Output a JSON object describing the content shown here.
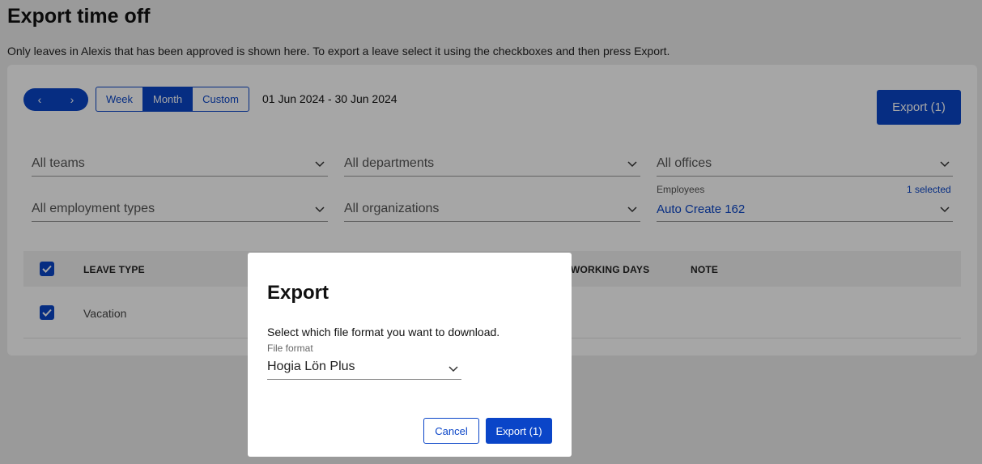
{
  "page": {
    "title": "Export time off",
    "description": "Only leaves in Alexis that has been approved is shown here. To export a leave select it using the checkboxes and then press Export."
  },
  "toolbar": {
    "prev_icon": "chevron-left-icon",
    "next_icon": "chevron-right-icon",
    "prev_label": "‹",
    "next_label": "›",
    "ranges": [
      "Week",
      "Month",
      "Custom"
    ],
    "active_range": "Month",
    "date_range": "01 Jun 2024 - 30 Jun 2024",
    "export_label": "Export (1)"
  },
  "filters": {
    "teams": "All teams",
    "departments": "All departments",
    "offices": "All offices",
    "employment_types": "All employment types",
    "organizations": "All organizations",
    "employees_label": "Employees",
    "employees_count": "1 selected",
    "employees_value": "Auto Create 162"
  },
  "table": {
    "headers": [
      "LEAVE TYPE",
      "WORKING DAYS",
      "NOTE"
    ],
    "rows": [
      {
        "leave_type": "Vacation",
        "checked": true
      }
    ]
  },
  "modal": {
    "title": "Export",
    "description": "Select which file format you want to download.",
    "file_format_label": "File format",
    "file_format_value": "Hogia Lön Plus",
    "cancel_label": "Cancel",
    "export_label": "Export (1)"
  },
  "colors": {
    "accent": "#0a45c8",
    "overlay": "rgba(0,0,0,0.35)"
  }
}
